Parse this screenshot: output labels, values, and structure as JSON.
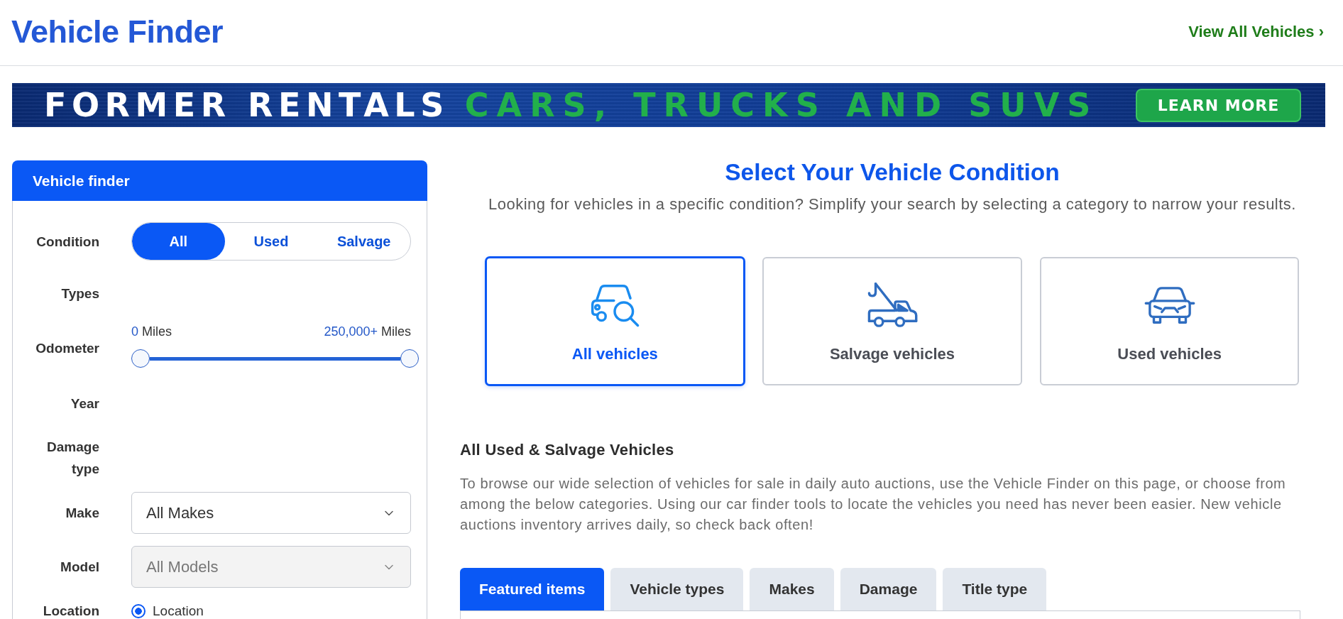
{
  "header": {
    "title": "Vehicle Finder",
    "link": "View All Vehicles ›"
  },
  "banner": {
    "headline": "FORMER RENTALS",
    "tagline": "CARS, TRUCKS AND SUVS",
    "button": "LEARN MORE"
  },
  "finder": {
    "title": "Vehicle finder",
    "fields": [
      {
        "kind": "segmented",
        "label": "Condition",
        "options": [
          {
            "label": "All",
            "selected": true
          },
          {
            "label": "Used",
            "selected": false
          },
          {
            "label": "Salvage",
            "selected": false
          }
        ]
      },
      {
        "kind": "label",
        "label": "Types"
      },
      {
        "kind": "range",
        "label": "Odometer",
        "min_value": "0",
        "min_unit": "Miles",
        "max_value": "250,000+",
        "max_unit": "Miles",
        "level": 1
      },
      {
        "kind": "label",
        "label": "Year"
      },
      {
        "kind": "label",
        "label": "Damage type"
      },
      {
        "kind": "select",
        "label": "Make",
        "value": "All Makes",
        "disabled": false
      },
      {
        "kind": "select",
        "label": "Model",
        "value": "All Models",
        "disabled": true
      },
      {
        "kind": "radio",
        "label": "Location",
        "options": [
          {
            "label": "Location",
            "selected": true
          }
        ]
      }
    ]
  },
  "condition": {
    "title": "Select Your Vehicle Condition",
    "subtitle": "Looking for vehicles in a specific condition? Simplify your search by selecting a category to narrow your results.",
    "cards": [
      {
        "label": "All vehicles",
        "selected": true
      },
      {
        "label": "Salvage vehicles",
        "selected": false
      },
      {
        "label": "Used vehicles",
        "selected": false
      }
    ]
  },
  "browse": {
    "title": "All Used & Salvage Vehicles",
    "text": "To browse our wide selection of vehicles for sale in daily auto auctions, use the Vehicle Finder on this page, or choose from among the below categories. Using our car finder tools to locate the vehicles you need has never been easier. New vehicle auctions inventory arrives daily, so check back often!",
    "tabs": [
      {
        "label": "Featured items",
        "selected": true
      },
      {
        "label": "Vehicle types",
        "selected": false
      },
      {
        "label": "Makes",
        "selected": false
      },
      {
        "label": "Damage",
        "selected": false
      },
      {
        "label": "Title type",
        "selected": false
      }
    ]
  }
}
